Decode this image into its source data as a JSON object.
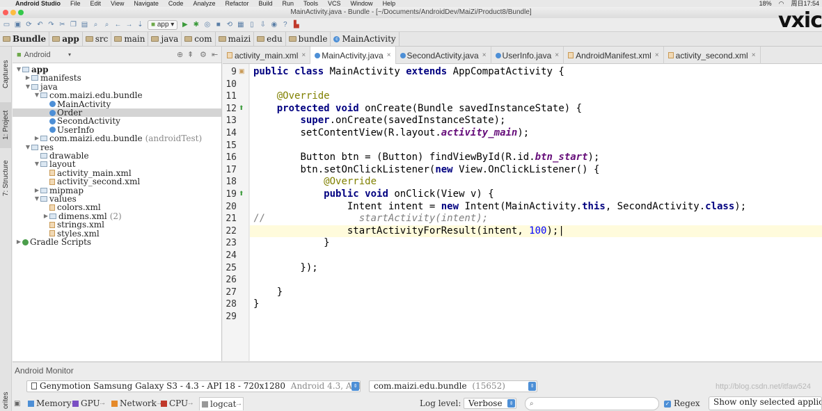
{
  "menubar": {
    "app_name": "Android Studio",
    "items": [
      "File",
      "Edit",
      "View",
      "Navigate",
      "Code",
      "Analyze",
      "Refactor",
      "Build",
      "Run",
      "Tools",
      "VCS",
      "Window",
      "Help"
    ],
    "battery": "18%",
    "clock": "周日17:54"
  },
  "window": {
    "title": "MainActivity.java - Bundle - [~/Documents/AndroidDev/MaiZi/Product8/Bundle]"
  },
  "toolbar": {
    "run_config": "app"
  },
  "breadcrumb": [
    "Bundle",
    "app",
    "src",
    "main",
    "java",
    "com",
    "maizi",
    "edu",
    "bundle",
    "MainActivity"
  ],
  "side_tabs": {
    "captures": "Captures",
    "project": "1: Project",
    "structure": "7: Structure",
    "favorites": "orites"
  },
  "project_panel": {
    "view_selector": "Android",
    "tree": [
      {
        "label": "app",
        "depth": 0,
        "type": "module",
        "expanded": true
      },
      {
        "label": "manifests",
        "depth": 1,
        "type": "folder",
        "expanded": false
      },
      {
        "label": "java",
        "depth": 1,
        "type": "folder",
        "expanded": true
      },
      {
        "label": "com.maizi.edu.bundle",
        "depth": 2,
        "type": "package",
        "expanded": true
      },
      {
        "label": "MainActivity",
        "depth": 3,
        "type": "class"
      },
      {
        "label": "Order",
        "depth": 3,
        "type": "class",
        "selected": true
      },
      {
        "label": "SecondActivity",
        "depth": 3,
        "type": "class"
      },
      {
        "label": "UserInfo",
        "depth": 3,
        "type": "class"
      },
      {
        "label": "com.maizi.edu.bundle",
        "suffix": "(androidTest)",
        "depth": 2,
        "type": "package",
        "expanded": false
      },
      {
        "label": "res",
        "depth": 1,
        "type": "folder",
        "expanded": true
      },
      {
        "label": "drawable",
        "depth": 2,
        "type": "folder"
      },
      {
        "label": "layout",
        "depth": 2,
        "type": "folder",
        "expanded": true
      },
      {
        "label": "activity_main.xml",
        "depth": 3,
        "type": "xml"
      },
      {
        "label": "activity_second.xml",
        "depth": 3,
        "type": "xml"
      },
      {
        "label": "mipmap",
        "depth": 2,
        "type": "folder",
        "expanded": false
      },
      {
        "label": "values",
        "depth": 2,
        "type": "folder",
        "expanded": true
      },
      {
        "label": "colors.xml",
        "depth": 3,
        "type": "xml"
      },
      {
        "label": "dimens.xml",
        "suffix": "(2)",
        "depth": 3,
        "type": "folder",
        "expanded": false
      },
      {
        "label": "strings.xml",
        "depth": 3,
        "type": "xml"
      },
      {
        "label": "styles.xml",
        "depth": 3,
        "type": "xml"
      },
      {
        "label": "Gradle Scripts",
        "depth": 0,
        "type": "gradle",
        "expanded": false
      }
    ]
  },
  "editor_tabs": [
    {
      "label": "activity_main.xml",
      "type": "xml"
    },
    {
      "label": "MainActivity.java",
      "type": "class",
      "active": true
    },
    {
      "label": "SecondActivity.java",
      "type": "class"
    },
    {
      "label": "UserInfo.java",
      "type": "class"
    },
    {
      "label": "AndroidManifest.xml",
      "type": "xml"
    },
    {
      "label": "activity_second.xml",
      "type": "xml"
    }
  ],
  "editor": {
    "current_line": 22,
    "lines": [
      {
        "n": "9",
        "text": "public class MainActivity extends AppCompatActivity {"
      },
      {
        "n": "10",
        "text": ""
      },
      {
        "n": "11",
        "text": "    @Override"
      },
      {
        "n": "12",
        "text": "    protected void onCreate(Bundle savedInstanceState) {"
      },
      {
        "n": "13",
        "text": "        super.onCreate(savedInstanceState);"
      },
      {
        "n": "14",
        "text": "        setContentView(R.layout.activity_main);"
      },
      {
        "n": "15",
        "text": ""
      },
      {
        "n": "16",
        "text": "        Button btn = (Button) findViewById(R.id.btn_start);"
      },
      {
        "n": "17",
        "text": "        btn.setOnClickListener(new View.OnClickListener() {"
      },
      {
        "n": "18",
        "text": "            @Override"
      },
      {
        "n": "19",
        "text": "            public void onClick(View v) {"
      },
      {
        "n": "20",
        "text": "                Intent intent = new Intent(MainActivity.this, SecondActivity.class);"
      },
      {
        "n": "21",
        "text": "//                startActivity(intent);"
      },
      {
        "n": "22",
        "text": "                startActivityForResult(intent, 100);"
      },
      {
        "n": "23",
        "text": "            }"
      },
      {
        "n": "24",
        "text": ""
      },
      {
        "n": "25",
        "text": "        });"
      },
      {
        "n": "26",
        "text": ""
      },
      {
        "n": "27",
        "text": "    }"
      },
      {
        "n": "28",
        "text": "}"
      },
      {
        "n": "29",
        "text": ""
      }
    ]
  },
  "monitor": {
    "title": "Android Monitor",
    "device": "Genymotion Samsung Galaxy S3 - 4.3 - API 18 - 720x1280",
    "device_os": "Android 4.3, API 18",
    "process": "com.maizi.edu.bundle",
    "process_pid": "(15652)",
    "tabs": [
      "Memory",
      "GPU",
      "Network",
      "CPU",
      "logcat"
    ],
    "active_tab": "logcat",
    "log_level_label": "Log level:",
    "log_level": "Verbose",
    "search_placeholder": "",
    "regex_label": "Regex",
    "regex_checked": true,
    "filter_option": "Show only selected applicati"
  },
  "watermark": "http://blog.csdn.net/itfaw524",
  "logo_text": "vxic"
}
